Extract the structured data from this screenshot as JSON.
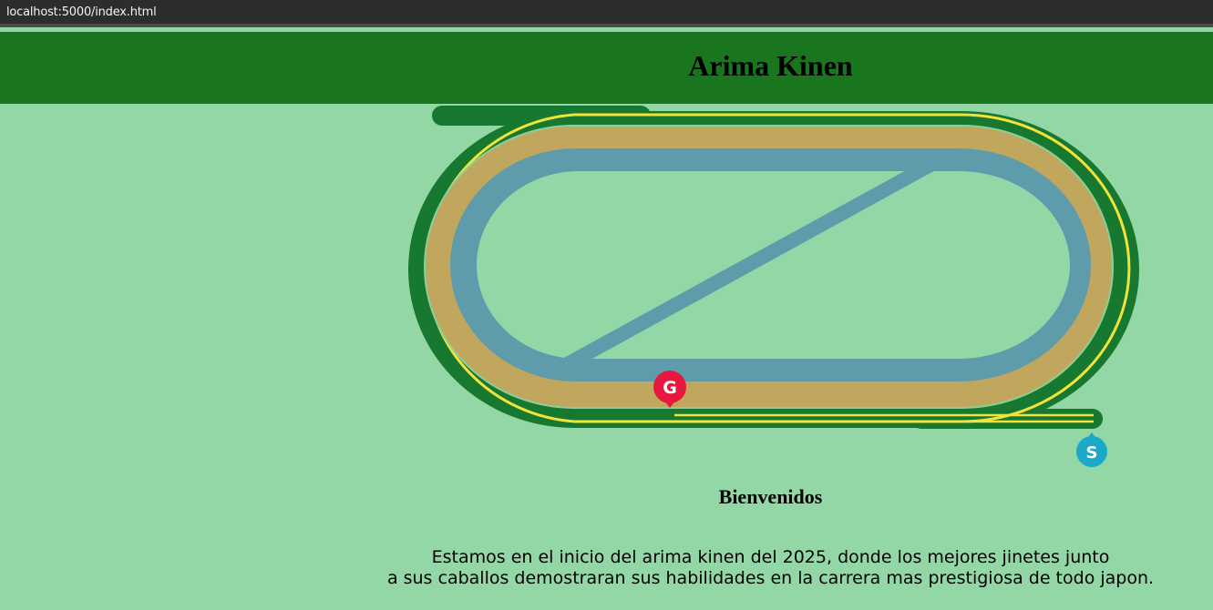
{
  "browser": {
    "url": "localhost:5000/index.html"
  },
  "header": {
    "title": "Arima Kinen"
  },
  "track_map": {
    "goal_marker": "G",
    "start_marker": "S",
    "colors": {
      "outer_green": "#17782f",
      "rail_yellow": "#f3e23a",
      "turf_tan": "#c1a75d",
      "dirt_blue": "#5e9cab",
      "goal_red": "#e8173f",
      "start_cyan": "#1ba9c9"
    }
  },
  "main": {
    "welcome": "Bienvenidos",
    "intro_line1": "Estamos en el inicio del arima kinen del 2025, donde los mejores jinetes junto",
    "intro_line2": "a sus caballos demostraran sus habilidades en la carrera mas prestigiosa de todo japon."
  }
}
